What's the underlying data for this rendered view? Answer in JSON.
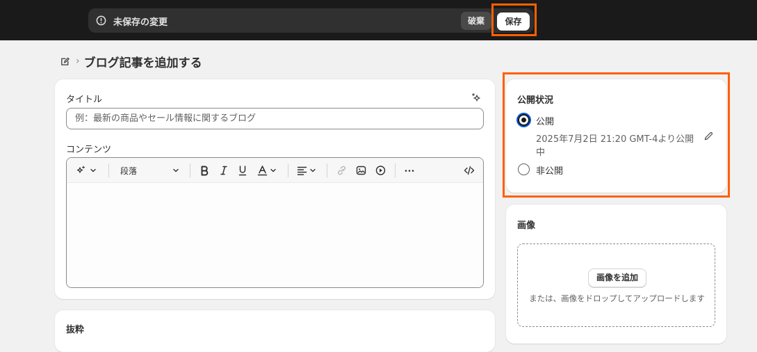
{
  "save_bar": {
    "message": "未保存の変更",
    "discard_label": "破棄",
    "save_label": "保存"
  },
  "header": {
    "title": "ブログ記事を追加する",
    "separator": "›"
  },
  "main": {
    "title_label": "タイトル",
    "title_placeholder": "例：最新の商品やセール情報に関するブログ",
    "content_label": "コンテンツ",
    "toolbar": {
      "paragraph_label": "段落"
    }
  },
  "excerpt": {
    "label": "抜粋"
  },
  "publish": {
    "heading": "公開状況",
    "option_public": "公開",
    "schedule_line1": "2025年7月2日 21:20 GMT-4より公開",
    "schedule_line2": "中",
    "option_private": "非公開"
  },
  "image": {
    "heading": "画像",
    "add_button": "画像を追加",
    "drop_hint": "または、画像をドロップしてアップロードします"
  },
  "colors": {
    "highlight": "#ff6000",
    "topbar": "#1a1a1a",
    "focus_ring": "#005bd3"
  }
}
